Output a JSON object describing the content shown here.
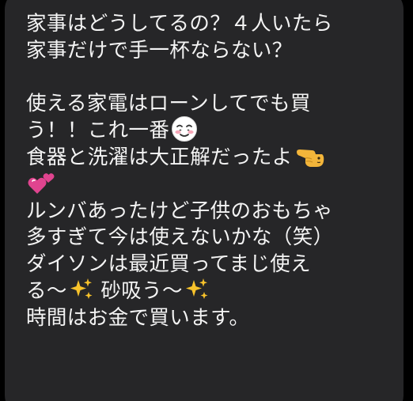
{
  "message": {
    "lines": [
      "家事はどうしてるの？４人いたら",
      "家事だけで手一杯ならない？",
      "",
      "使える家電はローンしてでも買",
      "う！！これ一番",
      "食器と洗濯は大正解だったよ",
      "",
      "ルンバあったけど子供のおもちゃ",
      "多すぎて今は使えないかな（笑）",
      "ダイソンは最近買ってまじ使え",
      "る〜",
      " 砂吸う〜",
      "時間はお金で買います。"
    ]
  },
  "emojis": {
    "relieved_face": "smiling-relieved-face-icon",
    "pointing_hand": "backhand-index-pointing-left-icon",
    "two_hearts": "two-hearts-icon",
    "sparkles": "sparkles-icon"
  },
  "colors": {
    "background": "#000000",
    "bubble": "#262628",
    "text": "#f4f4f4",
    "heart": "#e0448f",
    "sparkle": "#f7c22b",
    "hand": "#f3b53a"
  }
}
